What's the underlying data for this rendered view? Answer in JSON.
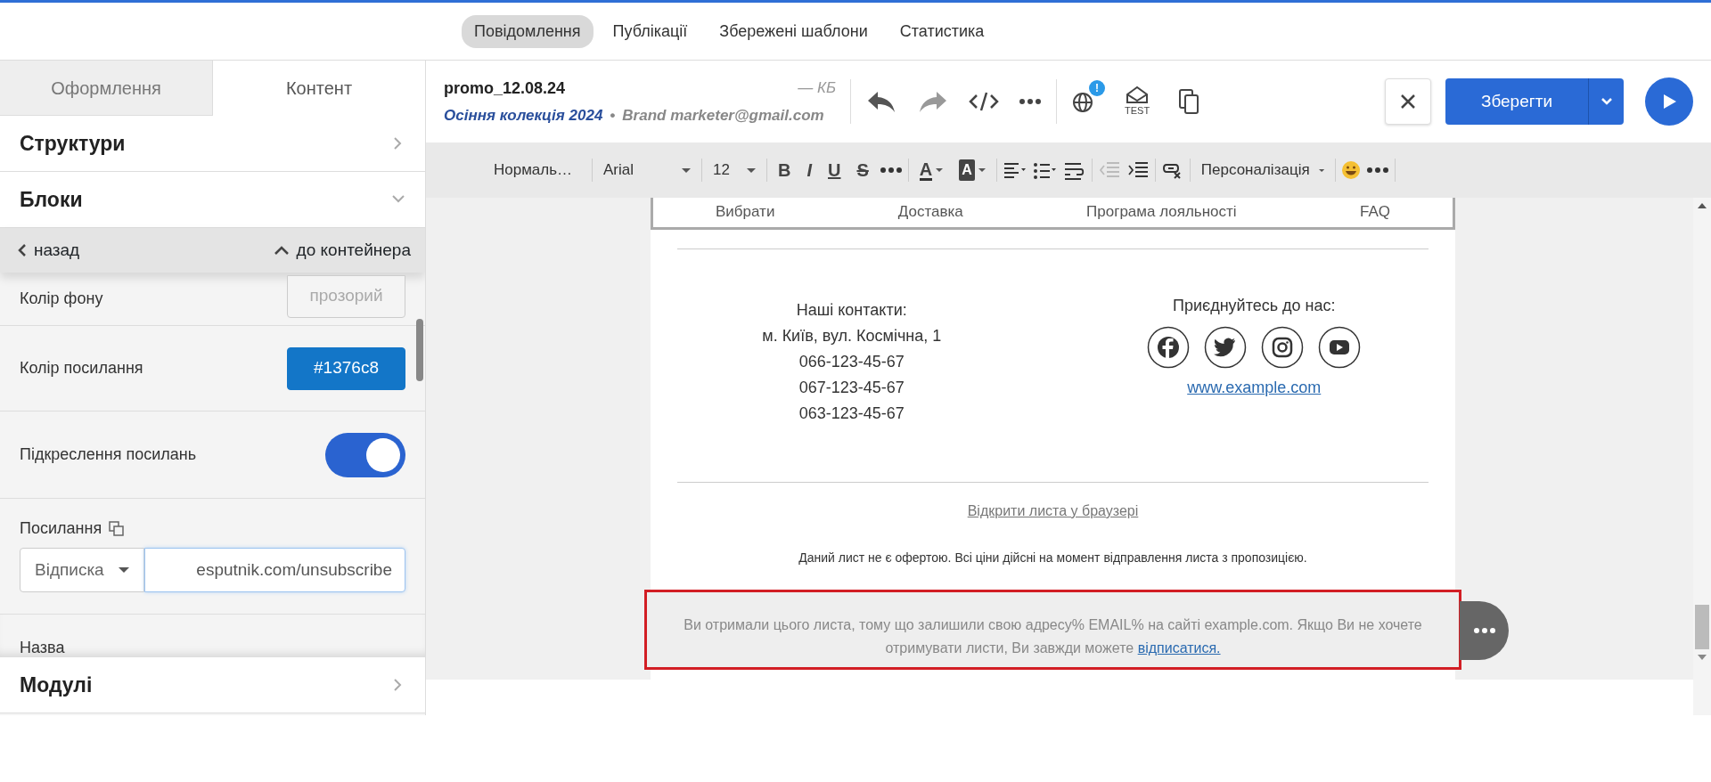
{
  "top_tabs": [
    {
      "label": "Повідомлення",
      "selected": true
    },
    {
      "label": "Публікації",
      "selected": false
    },
    {
      "label": "Збережені шаблони",
      "selected": false
    },
    {
      "label": "Статистика",
      "selected": false
    }
  ],
  "sidebar": {
    "tabs": [
      {
        "label": "Оформлення",
        "selected": false
      },
      {
        "label": "Контент",
        "selected": true
      }
    ],
    "sections": [
      {
        "label": "Структури",
        "expanded": false
      },
      {
        "label": "Блоки",
        "expanded": true
      }
    ],
    "back": "назад",
    "to_container": "до контейнера",
    "settings": [
      {
        "kind": "color",
        "label": "Колір фону",
        "value": "прозорий",
        "transparent": true
      },
      {
        "kind": "color",
        "label": "Колір посилання",
        "value": "#1376c8",
        "transparent": false
      },
      {
        "kind": "toggle",
        "label": "Підкреслення посилань",
        "on": true
      },
      {
        "kind": "link",
        "label": "Посилання",
        "type": "Відписка",
        "value": "esputnik.com/unsubscribe"
      },
      {
        "kind": "heading",
        "label": "Назва"
      }
    ],
    "bottom_section": {
      "label": "Модулі",
      "expanded": false
    }
  },
  "header": {
    "name": "promo_12.08.24",
    "subject": "Осіння колекція 2024",
    "separator": "•",
    "sender": "Brand marketer@gmail.com",
    "size": "— КБ",
    "badge": "!",
    "test_label": "TEST",
    "save": "Зберегти"
  },
  "toolbar": {
    "style": "Нормаль…",
    "font": "Arial",
    "size": "12",
    "format": [
      "B",
      "I",
      "U",
      "S"
    ],
    "text_color": "A",
    "highlight": "A",
    "personalization": "Персоналізація"
  },
  "email": {
    "menu": [
      "Вибрати",
      "Доставка",
      "Програма лояльності",
      "FAQ"
    ],
    "contacts_title": "Наші контакти:",
    "contacts": [
      "м. Київ, вул. Космічна, 1",
      "066-123-45-67",
      "067-123-45-67",
      "063-123-45-67"
    ],
    "join": "Приєднуйтесь до нас:",
    "website": "www.example.com",
    "browser_link": "Відкрити листа у браузері",
    "disclaimer": "Даний лист не є офертою. Всі ціни дійсні на момент відправлення листа з пропозицією.",
    "unsubscribe": {
      "text": "Ви отримали цього листа, тому що залишили свою адресу% EMAIL% на сайті example.com. Якщо Ви не хочете отримувати листи, Ви завжди можете ",
      "link": "відписатися.",
      "selected": true
    }
  }
}
